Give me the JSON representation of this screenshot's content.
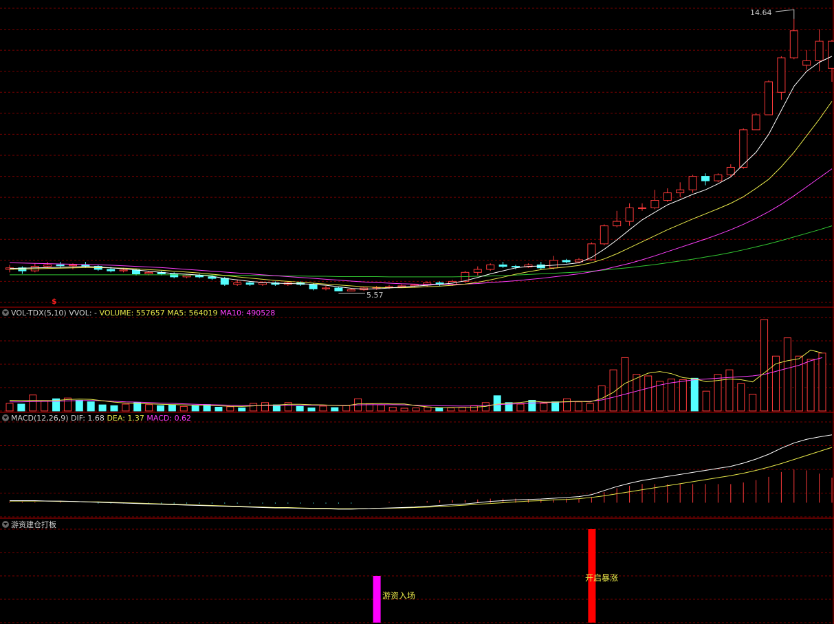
{
  "colors": {
    "up": "#ff3a3a",
    "down": "#54ffff",
    "ma5": "#ffffff",
    "ma10": "#e8e84a",
    "ma20": "#ff40ff",
    "ma60": "#32c832",
    "grid": "#7a0000",
    "sep": "#b40000"
  },
  "top_title": "",
  "price_panel": {
    "high_label": "14.64",
    "low_label": "5.57",
    "marker": "$"
  },
  "vol_panel": {
    "name": "VOL-TDX(5,10)",
    "vvol": "VVOL: -",
    "volume": "VOLUME: 557657",
    "ma5": "MA5: 564019",
    "ma10": "MA10: 490528"
  },
  "macd_panel": {
    "name": "MACD(12,26,9)",
    "dif": "DIF: 1.68",
    "dea": "DEA: 1.37",
    "macd": "MACD: 0.62"
  },
  "signal_panel": {
    "name": "游资建仓打板",
    "entry_label": "游资入场",
    "surge_label": "开启暴涨"
  },
  "chart_data": [
    {
      "type": "candlestick",
      "title": "",
      "ylim": [
        5.2,
        15.0
      ],
      "annotations": [
        {
          "text": "14.64",
          "value": 14.64
        },
        {
          "text": "5.57",
          "value": 5.57
        }
      ],
      "candles": [
        [
          6.3,
          6.35,
          6.45,
          6.2
        ],
        [
          6.35,
          6.25,
          6.4,
          6.15
        ],
        [
          6.25,
          6.4,
          6.5,
          6.2
        ],
        [
          6.4,
          6.45,
          6.55,
          6.35
        ],
        [
          6.45,
          6.42,
          6.55,
          6.35
        ],
        [
          6.42,
          6.45,
          6.5,
          6.3
        ],
        [
          6.45,
          6.4,
          6.55,
          6.35
        ],
        [
          6.4,
          6.3,
          6.45,
          6.25
        ],
        [
          6.3,
          6.25,
          6.38,
          6.2
        ],
        [
          6.25,
          6.28,
          6.35,
          6.2
        ],
        [
          6.28,
          6.15,
          6.32,
          6.1
        ],
        [
          6.15,
          6.2,
          6.25,
          6.1
        ],
        [
          6.2,
          6.15,
          6.25,
          6.1
        ],
        [
          6.15,
          6.05,
          6.2,
          6.0
        ],
        [
          6.05,
          6.1,
          6.15,
          6.0
        ],
        [
          6.1,
          6.05,
          6.15,
          6.0
        ],
        [
          6.05,
          6.0,
          6.1,
          5.95
        ],
        [
          6.0,
          5.8,
          6.05,
          5.75
        ],
        [
          5.8,
          5.85,
          5.95,
          5.75
        ],
        [
          5.85,
          5.8,
          5.9,
          5.75
        ],
        [
          5.8,
          5.85,
          5.9,
          5.75
        ],
        [
          5.85,
          5.8,
          5.9,
          5.75
        ],
        [
          5.8,
          5.85,
          5.9,
          5.75
        ],
        [
          5.85,
          5.8,
          5.9,
          5.75
        ],
        [
          5.8,
          5.65,
          5.85,
          5.6
        ],
        [
          5.65,
          5.68,
          5.75,
          5.6
        ],
        [
          5.68,
          5.58,
          5.72,
          5.57
        ],
        [
          5.58,
          5.62,
          5.68,
          5.57
        ],
        [
          5.62,
          5.68,
          5.72,
          5.58
        ],
        [
          5.68,
          5.7,
          5.75,
          5.62
        ],
        [
          5.7,
          5.72,
          5.78,
          5.65
        ],
        [
          5.72,
          5.75,
          5.8,
          5.68
        ],
        [
          5.75,
          5.78,
          5.82,
          5.7
        ],
        [
          5.78,
          5.85,
          5.9,
          5.72
        ],
        [
          5.85,
          5.8,
          5.9,
          5.75
        ],
        [
          5.8,
          5.9,
          5.95,
          5.75
        ],
        [
          5.9,
          6.2,
          6.25,
          5.85
        ],
        [
          6.2,
          6.3,
          6.4,
          6.1
        ],
        [
          6.3,
          6.45,
          6.5,
          6.25
        ],
        [
          6.45,
          6.4,
          6.55,
          6.35
        ],
        [
          6.4,
          6.38,
          6.45,
          6.3
        ],
        [
          6.38,
          6.45,
          6.5,
          6.35
        ],
        [
          6.45,
          6.35,
          6.55,
          6.3
        ],
        [
          6.35,
          6.6,
          6.75,
          6.3
        ],
        [
          6.6,
          6.55,
          6.65,
          6.5
        ],
        [
          6.55,
          6.62,
          6.68,
          6.5
        ],
        [
          6.62,
          7.15,
          7.2,
          6.6
        ],
        [
          7.15,
          7.75,
          7.8,
          7.1
        ],
        [
          7.75,
          7.9,
          8.25,
          7.7
        ],
        [
          7.9,
          8.35,
          8.5,
          7.75
        ],
        [
          8.35,
          8.35,
          8.5,
          8.25
        ],
        [
          8.35,
          8.6,
          8.95,
          8.3
        ],
        [
          8.6,
          8.85,
          9.0,
          8.55
        ],
        [
          8.85,
          8.95,
          9.2,
          8.7
        ],
        [
          8.95,
          9.4,
          9.45,
          8.85
        ],
        [
          9.4,
          9.25,
          9.5,
          9.1
        ],
        [
          9.25,
          9.45,
          9.5,
          9.2
        ],
        [
          9.45,
          9.7,
          9.8,
          9.4
        ],
        [
          9.7,
          10.95,
          11.0,
          9.65
        ],
        [
          10.95,
          11.45,
          11.5,
          10.95
        ],
        [
          11.45,
          12.55,
          12.6,
          12.4
        ],
        [
          12.2,
          13.35,
          13.4,
          11.95
        ],
        [
          13.35,
          14.25,
          14.64,
          13.3
        ],
        [
          13.1,
          13.25,
          13.6,
          12.95
        ],
        [
          13.25,
          13.9,
          14.3,
          12.9
        ],
        [
          13.0,
          13.9,
          13.95,
          12.55
        ]
      ],
      "ma5": [
        6.33,
        6.34,
        6.35,
        6.36,
        6.37,
        6.38,
        6.4,
        6.38,
        6.35,
        6.32,
        6.28,
        6.24,
        6.2,
        6.16,
        6.14,
        6.11,
        6.07,
        6.0,
        5.95,
        5.9,
        5.86,
        5.84,
        5.83,
        5.82,
        5.8,
        5.77,
        5.72,
        5.67,
        5.64,
        5.65,
        5.68,
        5.71,
        5.74,
        5.77,
        5.8,
        5.84,
        5.92,
        6.03,
        6.15,
        6.25,
        6.35,
        6.4,
        6.41,
        6.44,
        6.47,
        6.52,
        6.7,
        6.97,
        7.28,
        7.62,
        7.95,
        8.2,
        8.45,
        8.62,
        8.8,
        8.95,
        9.15,
        9.38,
        9.8,
        10.2,
        10.8,
        11.6,
        12.4,
        12.9,
        13.2,
        13.4
      ],
      "ma10": [
        6.3,
        6.31,
        6.32,
        6.33,
        6.34,
        6.35,
        6.36,
        6.36,
        6.35,
        6.34,
        6.32,
        6.29,
        6.27,
        6.24,
        6.21,
        6.18,
        6.14,
        6.1,
        6.05,
        6.01,
        5.97,
        5.93,
        5.9,
        5.87,
        5.84,
        5.81,
        5.78,
        5.75,
        5.72,
        5.7,
        5.69,
        5.69,
        5.7,
        5.72,
        5.74,
        5.77,
        5.81,
        5.87,
        5.95,
        6.04,
        6.14,
        6.22,
        6.29,
        6.34,
        6.38,
        6.43,
        6.52,
        6.65,
        6.82,
        7.02,
        7.22,
        7.42,
        7.62,
        7.8,
        7.98,
        8.15,
        8.32,
        8.5,
        8.72,
        9.0,
        9.3,
        9.72,
        10.2,
        10.75,
        11.3,
        11.9
      ],
      "ma20": [
        6.52,
        6.51,
        6.5,
        6.49,
        6.48,
        6.47,
        6.46,
        6.45,
        6.44,
        6.42,
        6.4,
        6.38,
        6.36,
        6.33,
        6.3,
        6.27,
        6.24,
        6.21,
        6.18,
        6.15,
        6.12,
        6.09,
        6.06,
        6.03,
        6.0,
        5.97,
        5.94,
        5.91,
        5.88,
        5.86,
        5.84,
        5.82,
        5.81,
        5.8,
        5.8,
        5.8,
        5.81,
        5.83,
        5.86,
        5.89,
        5.92,
        5.96,
        6.0,
        6.05,
        6.1,
        6.15,
        6.22,
        6.3,
        6.4,
        6.5,
        6.62,
        6.75,
        6.89,
        7.03,
        7.17,
        7.31,
        7.46,
        7.62,
        7.8,
        8.0,
        8.22,
        8.47,
        8.75,
        9.05,
        9.35,
        9.65
      ],
      "ma60": [
        6.12,
        6.12,
        6.12,
        6.12,
        6.12,
        6.12,
        6.12,
        6.12,
        6.12,
        6.12,
        6.12,
        6.12,
        6.12,
        6.12,
        6.11,
        6.11,
        6.11,
        6.1,
        6.1,
        6.1,
        6.09,
        6.09,
        6.08,
        6.08,
        6.07,
        6.07,
        6.06,
        6.06,
        6.06,
        6.06,
        6.05,
        6.05,
        6.05,
        6.05,
        6.05,
        6.05,
        6.06,
        6.07,
        6.08,
        6.09,
        6.11,
        6.13,
        6.15,
        6.17,
        6.19,
        6.21,
        6.24,
        6.28,
        6.32,
        6.36,
        6.41,
        6.46,
        6.52,
        6.58,
        6.64,
        6.71,
        6.78,
        6.86,
        6.95,
        7.05,
        7.15,
        7.26,
        7.38,
        7.5,
        7.62,
        7.75
      ]
    },
    {
      "type": "bar",
      "title": "VOL-TDX(5,10)",
      "ylim": [
        0,
        600000
      ],
      "values": [
        50000,
        45000,
        105000,
        65000,
        80000,
        85000,
        70000,
        60000,
        40000,
        35000,
        45000,
        55000,
        42000,
        35000,
        40000,
        30000,
        35000,
        42000,
        25000,
        28000,
        20000,
        50000,
        55000,
        40000,
        55000,
        30000,
        20000,
        32000,
        22000,
        35000,
        80000,
        48000,
        40000,
        25000,
        18000,
        20000,
        25000,
        20000,
        20000,
        24000,
        35000,
        55000,
        100000,
        55000,
        45000,
        70000,
        50000,
        60000,
        80000,
        60000,
        50000,
        165000,
        270000,
        350000,
        240000,
        230000,
        195000,
        210000,
        205000,
        215000,
        130000,
        240000,
        270000,
        180000,
        110000,
        600000,
        360000,
        480000,
        360000,
        340000,
        380000
      ],
      "ma5": [
        70000,
        68000,
        69000,
        68000,
        69000,
        75000,
        78000,
        76000,
        67000,
        58000,
        52000,
        49000,
        47000,
        44000,
        42000,
        40000,
        37000,
        37000,
        34000,
        31000,
        30000,
        33000,
        39000,
        39000,
        44000,
        44000,
        41000,
        40000,
        36000,
        34000,
        47000,
        47000,
        49000,
        46000,
        46000,
        35000,
        27000,
        22000,
        22000,
        23000,
        25000,
        30000,
        45000,
        51000,
        56000,
        65000,
        58000,
        58000,
        61000,
        63000,
        60000,
        82000,
        122000,
        181000,
        215000,
        248000,
        259000,
        245000,
        219000,
        211000,
        192000,
        200000,
        210000,
        205000,
        191000,
        250000,
        310000,
        330000,
        343000,
        400000,
        380000
      ],
      "ma10": [
        60000,
        60000,
        62000,
        63000,
        64000,
        66000,
        68000,
        69000,
        67000,
        64000,
        60000,
        58000,
        55000,
        52000,
        50000,
        47000,
        44000,
        42000,
        40000,
        38000,
        36000,
        35000,
        36000,
        36000,
        37000,
        38000,
        38000,
        38000,
        37000,
        36000,
        40000,
        41000,
        42000,
        41000,
        40000,
        38000,
        36000,
        34000,
        33000,
        32000,
        33000,
        36000,
        42000,
        45000,
        48000,
        52000,
        54000,
        57000,
        60000,
        62000,
        64000,
        72000,
        90000,
        110000,
        130000,
        150000,
        170000,
        185000,
        195000,
        205000,
        210000,
        215000,
        220000,
        225000,
        230000,
        240000,
        260000,
        280000,
        300000,
        330000,
        350000
      ],
      "series_colors": "up=red outline, down=cyan fill"
    },
    {
      "type": "line",
      "title": "MACD(12,26,9)",
      "ylim": [
        -0.35,
        2.0
      ],
      "dif": [
        0.05,
        0.05,
        0.05,
        0.04,
        0.04,
        0.03,
        0.02,
        0.01,
        0.0,
        -0.01,
        -0.02,
        -0.03,
        -0.04,
        -0.05,
        -0.06,
        -0.07,
        -0.08,
        -0.09,
        -0.1,
        -0.11,
        -0.12,
        -0.13,
        -0.13,
        -0.14,
        -0.15,
        -0.15,
        -0.16,
        -0.16,
        -0.15,
        -0.14,
        -0.13,
        -0.12,
        -0.11,
        -0.09,
        -0.07,
        -0.05,
        -0.03,
        0.0,
        0.03,
        0.05,
        0.07,
        0.08,
        0.09,
        0.11,
        0.13,
        0.15,
        0.2,
        0.3,
        0.4,
        0.48,
        0.55,
        0.6,
        0.65,
        0.7,
        0.75,
        0.8,
        0.85,
        0.9,
        0.98,
        1.08,
        1.2,
        1.35,
        1.48,
        1.57,
        1.63,
        1.68
      ],
      "dea": [
        0.04,
        0.04,
        0.04,
        0.04,
        0.03,
        0.03,
        0.02,
        0.02,
        0.01,
        0.0,
        -0.01,
        -0.02,
        -0.03,
        -0.04,
        -0.05,
        -0.06,
        -0.07,
        -0.08,
        -0.09,
        -0.1,
        -0.11,
        -0.12,
        -0.12,
        -0.13,
        -0.14,
        -0.14,
        -0.15,
        -0.15,
        -0.15,
        -0.14,
        -0.14,
        -0.13,
        -0.12,
        -0.11,
        -0.1,
        -0.08,
        -0.06,
        -0.04,
        -0.02,
        0.0,
        0.02,
        0.04,
        0.05,
        0.07,
        0.08,
        0.1,
        0.13,
        0.17,
        0.22,
        0.27,
        0.32,
        0.37,
        0.42,
        0.47,
        0.52,
        0.57,
        0.62,
        0.67,
        0.73,
        0.8,
        0.88,
        0.97,
        1.07,
        1.17,
        1.27,
        1.37
      ],
      "macd": [
        0.02,
        0.02,
        0.02,
        0.0,
        0.02,
        0.0,
        0.0,
        -0.02,
        -0.02,
        -0.02,
        -0.02,
        -0.02,
        -0.02,
        -0.02,
        -0.02,
        -0.02,
        -0.02,
        -0.02,
        -0.02,
        -0.02,
        -0.02,
        -0.02,
        -0.02,
        -0.02,
        -0.02,
        -0.02,
        -0.02,
        -0.02,
        0.0,
        0.0,
        0.02,
        0.02,
        0.02,
        0.04,
        0.06,
        0.06,
        0.06,
        0.08,
        0.1,
        0.1,
        0.1,
        0.08,
        0.08,
        0.08,
        0.1,
        0.1,
        0.14,
        0.26,
        0.36,
        0.42,
        0.46,
        0.46,
        0.46,
        0.46,
        0.46,
        0.46,
        0.46,
        0.46,
        0.5,
        0.56,
        0.64,
        0.76,
        0.82,
        0.8,
        0.72,
        0.62
      ]
    },
    {
      "type": "bar",
      "title": "游资建仓打板",
      "signals": [
        {
          "index": 29,
          "label": "游资入场",
          "color": "#ff00ff",
          "value": 0.5
        },
        {
          "index": 46,
          "label": "开启暴涨",
          "color": "#ff0000",
          "value": 1.0
        }
      ]
    }
  ]
}
